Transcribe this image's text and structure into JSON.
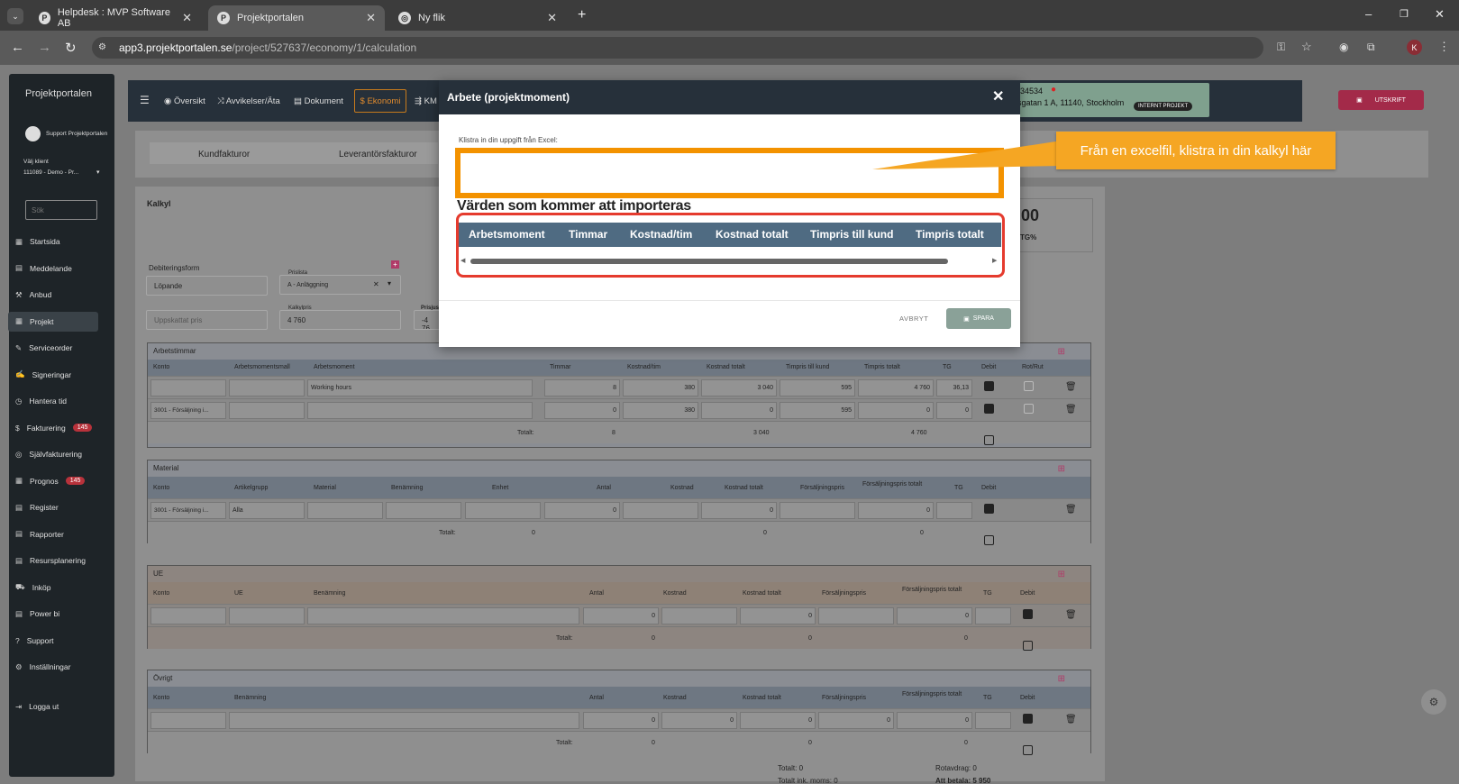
{
  "browser": {
    "tabs": [
      {
        "label": "Helpdesk : MVP Software AB",
        "icon": "helpdesk-favicon",
        "active": false
      },
      {
        "label": "Projektportalen",
        "icon": "projektportalen-favicon",
        "active": true
      },
      {
        "label": "Ny flik",
        "icon": "chrome-favicon",
        "active": false
      }
    ],
    "url_host": "app3.projektportalen.se",
    "url_path": "/project/527637/economy/1/calculation",
    "profile_initial": "K"
  },
  "sidebar": {
    "logo": "Projektportalen",
    "user": "Support Projektportalen",
    "client_label": "Välj klient",
    "client_value": "111089 - Demo - Pr...",
    "search_placeholder": "Sök",
    "items": [
      {
        "label": "Startsida",
        "badge": ""
      },
      {
        "label": "Meddelande",
        "badge": ""
      },
      {
        "label": "Anbud",
        "badge": ""
      },
      {
        "label": "Projekt",
        "badge": ""
      },
      {
        "label": "Serviceorder",
        "badge": ""
      },
      {
        "label": "Signeringar",
        "badge": ""
      },
      {
        "label": "Hantera tid",
        "badge": ""
      },
      {
        "label": "Fakturering",
        "badge": "145"
      },
      {
        "label": "Självfakturering",
        "badge": ""
      },
      {
        "label": "Prognos",
        "badge": "145"
      },
      {
        "label": "Register",
        "badge": ""
      },
      {
        "label": "Rapporter",
        "badge": ""
      },
      {
        "label": "Resursplanering",
        "badge": ""
      },
      {
        "label": "Inköp",
        "badge": ""
      },
      {
        "label": "Power bi",
        "badge": ""
      },
      {
        "label": "Support",
        "badge": ""
      },
      {
        "label": "Inställningar",
        "badge": ""
      }
    ],
    "logout": "Logga ut"
  },
  "topnav": {
    "items": [
      "Översikt",
      "Avvikelser/Äta",
      "Dokument"
    ],
    "economy": "$ Ekonomi",
    "km": "KM",
    "project_no": "34534",
    "address": "sgatan 1 A, 11140, Stockholm",
    "pill": "INTERNT PROJEKT",
    "print": "UTSKRIFT"
  },
  "economy_tabs": [
    "Kundfakturor",
    "Leverantörsfakturor"
  ],
  "calc": {
    "title": "Kalkyl",
    "big_value": ",00",
    "big_label": "TG%",
    "debit_label": "Debiteringsform",
    "debit_value": "Löpande",
    "pricelist_label": "Prislista",
    "pricelist_value": "A - Anläggning",
    "estimated_placeholder": "Uppskattat pris",
    "calc_price_label": "Kalkylpris",
    "calc_price_value": "4 760",
    "prisjust_label": "Prisjus",
    "prisjust_value": "-4 76"
  },
  "arbetstimmar": {
    "title": "Arbetstimmar",
    "headers": [
      "Konto",
      "Arbetsmomentsmall",
      "Arbetsmoment",
      "Timmar",
      "Kostnad/tim",
      "Kostnad totalt",
      "Timpris till kund",
      "Timpris totalt",
      "TG",
      "Debit",
      "Rot/Rut"
    ],
    "rows": [
      {
        "konto": "",
        "moment": "Working hours",
        "timmar": "8",
        "kostnad": "380",
        "kostnad_tot": "3 040",
        "timpris": "595",
        "timpris_tot": "4 760",
        "tg": "36,13"
      },
      {
        "konto": "3001 - Försäljning i...",
        "moment": "",
        "timmar": "0",
        "kostnad": "380",
        "kostnad_tot": "0",
        "timpris": "595",
        "timpris_tot": "0",
        "tg": "0"
      }
    ],
    "total_label": "Totalt:",
    "total_timmar": "8",
    "total_kostnad": "3 040",
    "total_timpris": "4 760"
  },
  "material": {
    "title": "Material",
    "headers": [
      "Konto",
      "Artikelgrupp",
      "Material",
      "Benämning",
      "Enhet",
      "Antal",
      "Kostnad",
      "Kostnad totalt",
      "Försäljningspris",
      "Försäljningspris totalt",
      "TG",
      "Debit"
    ],
    "row": {
      "konto": "3001 - Försäljning i...",
      "grupp": "Alla",
      "antal": "0",
      "kostnad_tot": "0",
      "fp_tot": "0"
    },
    "total_label": "Totalt:",
    "total_antal": "0",
    "total_kostnad": "0",
    "total_fp": "0"
  },
  "ue": {
    "title": "UE",
    "headers": [
      "Konto",
      "UE",
      "Benämning",
      "Antal",
      "Kostnad",
      "Kostnad totalt",
      "Försäljningspris",
      "Försäljningspris totalt",
      "TG",
      "Debit"
    ],
    "row": {
      "antal": "0",
      "kostnad_tot": "0",
      "fp_tot": "0"
    },
    "total_label": "Totalt:",
    "total_antal": "0",
    "total_kostnad": "0",
    "total_fp": "0"
  },
  "ovrigt": {
    "title": "Övrigt",
    "headers": [
      "Konto",
      "Benämning",
      "Antal",
      "Kostnad",
      "Kostnad totalt",
      "Försäljningspris",
      "Försäljningspris totalt",
      "TG",
      "Debit"
    ],
    "row": {
      "antal": "0",
      "kostnad": "0",
      "kostnad_tot": "0",
      "fp": "0",
      "fp_tot": "0"
    },
    "total_label": "Totalt:",
    "total_antal": "0",
    "total_kostnad": "0",
    "total_fp": "0"
  },
  "footer": {
    "totalt": "Totalt: 0",
    "rotavdrag": "Rotavdrag: 0",
    "totalt_moms": "Totalt ink. moms: 0",
    "att_betala": "Att betala: 5 950"
  },
  "modal": {
    "title": "Arbete (projektmoment)",
    "paste_label": "Klistra in din uppgift från Excel:",
    "paste_value": "",
    "import_title": "Värden som kommer att importeras",
    "columns": [
      "Arbetsmoment",
      "Timmar",
      "Kostnad/tim",
      "Kostnad totalt",
      "Timpris till kund",
      "Timpris totalt"
    ],
    "cancel": "AVBRYT",
    "save": "SPARA"
  },
  "tooltip": "Från en excelfil, klistra in din kalkyl här",
  "colors": {
    "accent_orange": "#f39200",
    "highlight_red": "#e53b2e",
    "header_blue": "#4f6b82",
    "modal_dark": "#26303a",
    "print_red": "#a32a49"
  }
}
